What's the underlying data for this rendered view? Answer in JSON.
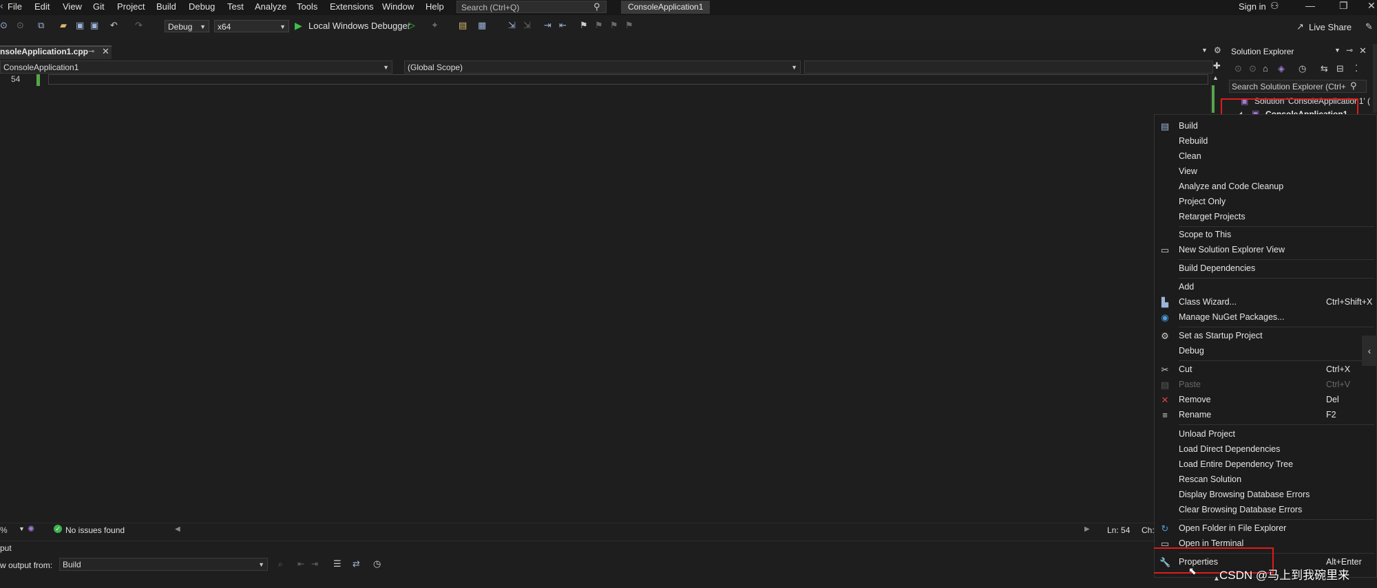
{
  "menubar": {
    "items": [
      "File",
      "Edit",
      "View",
      "Git",
      "Project",
      "Build",
      "Debug",
      "Test",
      "Analyze",
      "Tools",
      "Extensions",
      "Window",
      "Help"
    ],
    "search_placeholder": "Search (Ctrl+Q)",
    "solution_name": "ConsoleApplication1",
    "sign_in": "Sign in"
  },
  "toolbar": {
    "configuration": "Debug",
    "platform": "x64",
    "debugger_label": "Local Windows Debugger",
    "live_share": "Live Share"
  },
  "editor": {
    "file_tab": "nsoleApplication1.cpp",
    "nav_project": "ConsoleApplication1",
    "nav_scope": "(Global Scope)",
    "line_number": "54"
  },
  "solution_explorer": {
    "title": "Solution Explorer",
    "search_placeholder": "Search Solution Explorer (Ctrl+",
    "solution_item": "Solution 'ConsoleApplication1' (",
    "project_item": "ConsoleApplication1"
  },
  "context_menu": {
    "items": [
      {
        "label": "Build",
        "icon": "build-icon",
        "shortcut": "",
        "disabled": false
      },
      {
        "label": "Rebuild",
        "icon": "",
        "shortcut": "",
        "disabled": false
      },
      {
        "label": "Clean",
        "icon": "",
        "shortcut": "",
        "disabled": false
      },
      {
        "label": "View",
        "icon": "",
        "shortcut": "",
        "disabled": false
      },
      {
        "label": "Analyze and Code Cleanup",
        "icon": "",
        "shortcut": "",
        "disabled": false
      },
      {
        "label": "Project Only",
        "icon": "",
        "shortcut": "",
        "disabled": false
      },
      {
        "label": "Retarget Projects",
        "icon": "",
        "shortcut": "",
        "disabled": false
      },
      {
        "label": "Scope to This",
        "icon": "",
        "shortcut": "",
        "disabled": false
      },
      {
        "label": "New Solution Explorer View",
        "icon": "new-view-icon",
        "shortcut": "",
        "disabled": false
      },
      {
        "label": "Build Dependencies",
        "icon": "",
        "shortcut": "",
        "disabled": false
      },
      {
        "label": "Add",
        "icon": "",
        "shortcut": "",
        "disabled": false
      },
      {
        "label": "Class Wizard...",
        "icon": "class-wizard-icon",
        "shortcut": "Ctrl+Shift+X",
        "disabled": false
      },
      {
        "label": "Manage NuGet Packages...",
        "icon": "nuget-icon",
        "shortcut": "",
        "disabled": false
      },
      {
        "label": "Set as Startup Project",
        "icon": "gear-icon",
        "shortcut": "",
        "disabled": false
      },
      {
        "label": "Debug",
        "icon": "",
        "shortcut": "",
        "disabled": false
      },
      {
        "label": "Cut",
        "icon": "scissors-icon",
        "shortcut": "Ctrl+X",
        "disabled": false
      },
      {
        "label": "Paste",
        "icon": "paste-icon",
        "shortcut": "Ctrl+V",
        "disabled": true
      },
      {
        "label": "Remove",
        "icon": "remove-icon",
        "shortcut": "Del",
        "disabled": false
      },
      {
        "label": "Rename",
        "icon": "rename-icon",
        "shortcut": "F2",
        "disabled": false
      },
      {
        "label": "Unload Project",
        "icon": "",
        "shortcut": "",
        "disabled": false
      },
      {
        "label": "Load Direct Dependencies",
        "icon": "",
        "shortcut": "",
        "disabled": false
      },
      {
        "label": "Load Entire Dependency Tree",
        "icon": "",
        "shortcut": "",
        "disabled": false
      },
      {
        "label": "Rescan Solution",
        "icon": "",
        "shortcut": "",
        "disabled": false
      },
      {
        "label": "Display Browsing Database Errors",
        "icon": "",
        "shortcut": "",
        "disabled": false
      },
      {
        "label": "Clear Browsing Database Errors",
        "icon": "",
        "shortcut": "",
        "disabled": false
      },
      {
        "label": "Open Folder in File Explorer",
        "icon": "open-folder-icon",
        "shortcut": "",
        "disabled": false
      },
      {
        "label": "Open in Terminal",
        "icon": "terminal-icon",
        "shortcut": "",
        "disabled": false
      },
      {
        "label": "Properties",
        "icon": "wrench-icon",
        "shortcut": "Alt+Enter",
        "disabled": false
      }
    ]
  },
  "statusbar": {
    "zoom": "%",
    "issues": "No issues found",
    "position": "Ln: 54",
    "char": "Ch:"
  },
  "output": {
    "title": "put",
    "show_from_label": "w output from:",
    "source": "Build"
  },
  "watermark": "CSDN @马上到我碗里来",
  "colors": {
    "accent_red": "#e01b1b",
    "play_green": "#3fbf4a",
    "change_green": "#57a64a"
  }
}
